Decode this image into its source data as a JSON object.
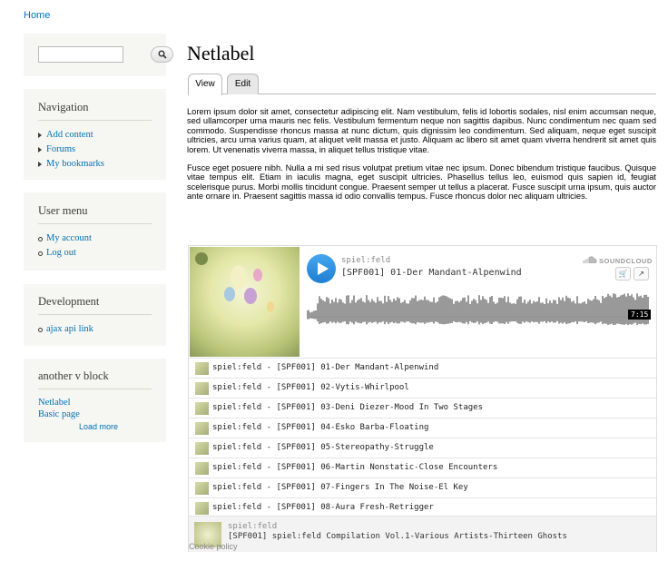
{
  "breadcrumb": {
    "home": "Home"
  },
  "search": {
    "placeholder": ""
  },
  "navigation": {
    "title": "Navigation",
    "items": [
      "Add content",
      "Forums",
      "My bookmarks"
    ]
  },
  "user_menu": {
    "title": "User menu",
    "items": [
      "My account",
      "Log out"
    ]
  },
  "development": {
    "title": "Development",
    "items": [
      "ajax api link"
    ]
  },
  "another_block": {
    "title": "another v block",
    "links": [
      "Netlabel",
      "Basic page"
    ],
    "load_more": "Load more"
  },
  "page": {
    "title": "Netlabel",
    "tabs": [
      "View",
      "Edit"
    ],
    "paragraphs": [
      "Lorem ipsum dolor sit amet, consectetur adipiscing elit. Nam vestibulum, felis id lobortis sodales, nisl enim accumsan neque, sed ullamcorper urna mauris nec felis. Vestibulum fermentum neque non sagittis dapibus. Nunc condimentum nec quam sed commodo. Suspendisse rhoncus massa at nunc dictum, quis dignissim leo condimentum. Sed aliquam, neque eget suscipit ultricies, arcu urna varius quam, at aliquet velit massa et justo. Aliquam ac libero sit amet quam viverra hendrerit sit amet quis lorem. Ut venenatis viverra massa, in aliquet tellus tristique vitae.",
      "Fusce eget posuere nibh. Nulla a mi sed risus volutpat pretium vitae nec ipsum. Donec bibendum tristique faucibus. Quisque vitae tempus elit. Etiam in iaculis magna, eget suscipit ultricies. Phasellus tellus leo, euismod quis sapien id, feugiat scelerisque purus. Morbi mollis tincidunt congue. Praesent semper ut tellus a placerat. Fusce suscipit urna ipsum, quis auctor ante ornare in. Praesent sagittis massa id odio convallis tempus. Fusce rhoncus dolor nec aliquam ultricies."
    ]
  },
  "player": {
    "user": "spiel:feld",
    "title": "[SPF001] 01-Der Mandant-Alpenwind",
    "brand": "SOUNDCLOUD",
    "duration": "7:15",
    "progress": 0,
    "tracks": [
      "spiel:feld - [SPF001] 01-Der Mandant-Alpenwind",
      "spiel:feld - [SPF001] 02-Vytis-Whirlpool",
      "spiel:feld - [SPF001] 03-Deni Diezer-Mood In Two Stages",
      "spiel:feld - [SPF001] 04-Esko Barba-Floating",
      "spiel:feld - [SPF001] 05-Stereopathy-Struggle",
      "spiel:feld - [SPF001] 06-Martin Nonstatic-Close Encounters",
      "spiel:feld - [SPF001] 07-Fingers In The Noise-El Key",
      "spiel:feld - [SPF001] 08-Aura Fresh-Retrigger"
    ],
    "set": {
      "user": "spiel:feld",
      "title": "[SPF001] spiel:feld Compilation Vol.1-Various Artists-Thirteen Ghosts"
    }
  },
  "footer": {
    "cookie": "Cookie policy"
  }
}
